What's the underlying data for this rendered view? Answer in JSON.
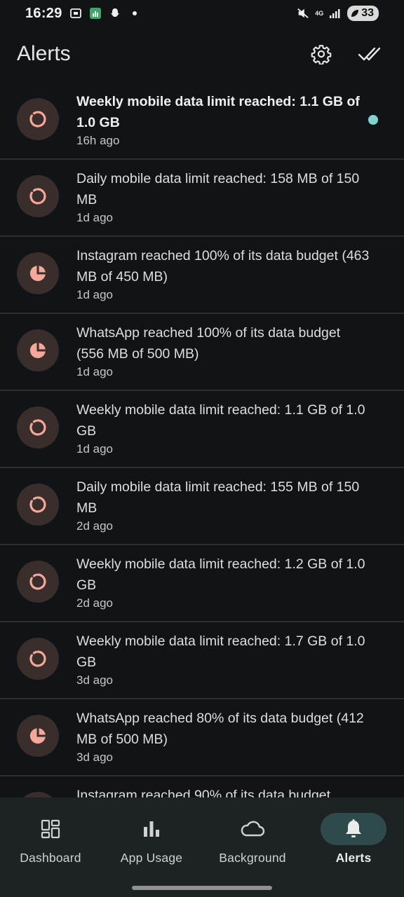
{
  "status_bar": {
    "time": "16:29",
    "network": "4G",
    "battery": "33"
  },
  "header": {
    "title": "Alerts",
    "settings_icon": "gear-icon",
    "mark_all_read_icon": "double-check-icon"
  },
  "alerts": [
    {
      "title": "Weekly mobile data limit reached: 1.1 GB of 1.0 GB",
      "time": "16h ago",
      "icon": "data-limit-ring-icon",
      "unread": true
    },
    {
      "title": "Daily mobile data limit reached: 158 MB of 150 MB",
      "time": "1d ago",
      "icon": "data-limit-ring-icon",
      "unread": false
    },
    {
      "title": "Instagram reached 100% of its data budget (463 MB of 450 MB)",
      "time": "1d ago",
      "icon": "data-budget-pie-icon",
      "unread": false
    },
    {
      "title": "WhatsApp reached 100% of its data budget (556 MB of 500 MB)",
      "time": "1d ago",
      "icon": "data-budget-pie-icon",
      "unread": false
    },
    {
      "title": "Weekly mobile data limit reached: 1.1 GB of 1.0 GB",
      "time": "1d ago",
      "icon": "data-limit-ring-icon",
      "unread": false
    },
    {
      "title": "Daily mobile data limit reached: 155 MB of 150 MB",
      "time": "2d ago",
      "icon": "data-limit-ring-icon",
      "unread": false
    },
    {
      "title": "Weekly mobile data limit reached: 1.2 GB of 1.0 GB",
      "time": "2d ago",
      "icon": "data-limit-ring-icon",
      "unread": false
    },
    {
      "title": "Weekly mobile data limit reached: 1.7 GB of 1.0 GB",
      "time": "3d ago",
      "icon": "data-limit-ring-icon",
      "unread": false
    },
    {
      "title": "WhatsApp reached 80% of its data budget (412 MB of 500 MB)",
      "time": "3d ago",
      "icon": "data-budget-pie-icon",
      "unread": false
    },
    {
      "title": "Instagram reached 90% of its data budget",
      "time": "",
      "icon": "data-budget-pie-icon",
      "unread": false
    }
  ],
  "bottom_nav": {
    "items": [
      {
        "label": "Dashboard",
        "icon": "dashboard-icon",
        "active": false
      },
      {
        "label": "App Usage",
        "icon": "bar-chart-icon",
        "active": false
      },
      {
        "label": "Background",
        "icon": "cloud-icon",
        "active": false
      },
      {
        "label": "Alerts",
        "icon": "bell-icon",
        "active": true
      }
    ]
  },
  "colors": {
    "background": "#111416",
    "accent": "#f4a899",
    "unread_dot": "#7fd4cf",
    "active_nav": "#2f4a4a"
  }
}
